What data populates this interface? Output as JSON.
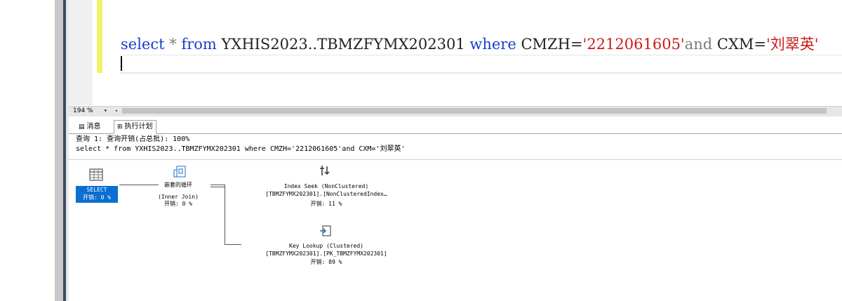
{
  "editor": {
    "query_parts": {
      "select": "select",
      "star": "*",
      "from": "from",
      "table": "YXHIS2023..TBMZFYMX202301",
      "where": "where",
      "col1": "CMZH=",
      "val1": "'2212061605'",
      "and": "and",
      "col2": "CXM=",
      "val2": "'刘翠英'"
    }
  },
  "statusbar": {
    "zoom": "194 %"
  },
  "tabs": {
    "messages": "消息",
    "execution_plan": "执行计划"
  },
  "plan": {
    "header_line1": "查询 1: 查询开销(占总批): 100%",
    "header_line2": "select * from YXHIS2023..TBMZFYMX202301 where CMZH='2212061605'and CXM='刘翠英'",
    "select_node": {
      "label": "SELECT",
      "cost": "开销: 0 %"
    },
    "nested_loop": {
      "label": "嵌套的循环",
      "subtype": "(Inner Join)",
      "cost": "开销: 0 %"
    },
    "index_seek": {
      "label": "Index Seek (NonClustered)",
      "object": "[TBMZFYMX202301].[NonClusteredIndex…",
      "cost": "开销: 11 %"
    },
    "key_lookup": {
      "label": "Key Lookup (Clustered)",
      "object": "[TBMZFYMX202301].[PK_TBMZFYMX202301]",
      "cost": "开销: 89 %"
    }
  },
  "colors": {
    "keyword": "#1a3ec7",
    "string": "#c81b1b",
    "select_node": "#0a6fd0"
  }
}
